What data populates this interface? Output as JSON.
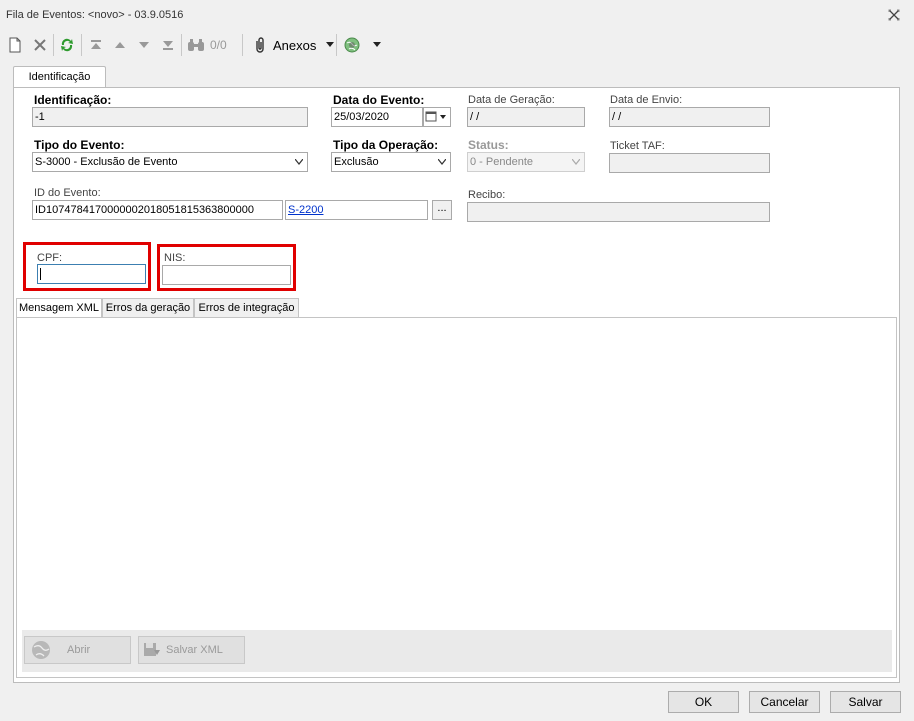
{
  "window": {
    "title": "Fila de Eventos: <novo> - 03.9.0516"
  },
  "toolbar": {
    "counter": "0/0",
    "attachments_label": "Anexos"
  },
  "tabs": {
    "main": "Identificação",
    "sub": [
      "Mensagem XML",
      "Erros da geração",
      "Erros de integração"
    ]
  },
  "form": {
    "identificacao": {
      "label": "Identificação:",
      "value": "-1"
    },
    "data_evento": {
      "label": "Data do Evento:",
      "value": "25/03/2020"
    },
    "data_geracao": {
      "label": "Data de Geração:",
      "value": " / /"
    },
    "data_envio": {
      "label": "Data de Envio:",
      "value": " / /"
    },
    "tipo_evento": {
      "label": "Tipo do Evento:",
      "value": "S-3000 - Exclusão de Evento"
    },
    "tipo_operacao": {
      "label": "Tipo da Operação:",
      "value": "Exclusão"
    },
    "status": {
      "label": "Status:",
      "value": "0 - Pendente"
    },
    "ticket_taf": {
      "label": "Ticket TAF:",
      "value": ""
    },
    "id_evento": {
      "label": "ID do Evento:",
      "value": "ID1074784170000002018051815363800000",
      "link": "S-2200",
      "browse": "..."
    },
    "recibo": {
      "label": "Recibo:",
      "value": ""
    },
    "cpf": {
      "label": "CPF:",
      "value": ""
    },
    "nis": {
      "label": "NIS:",
      "value": ""
    }
  },
  "actions": {
    "abrir": "Abrir",
    "salvar_xml": "Salvar XML"
  },
  "buttons": {
    "ok": "OK",
    "cancelar": "Cancelar",
    "salvar": "Salvar"
  },
  "colors": {
    "highlight": "#e00000",
    "link": "#0033cc",
    "refresh_icon": "#2e9a2e"
  }
}
